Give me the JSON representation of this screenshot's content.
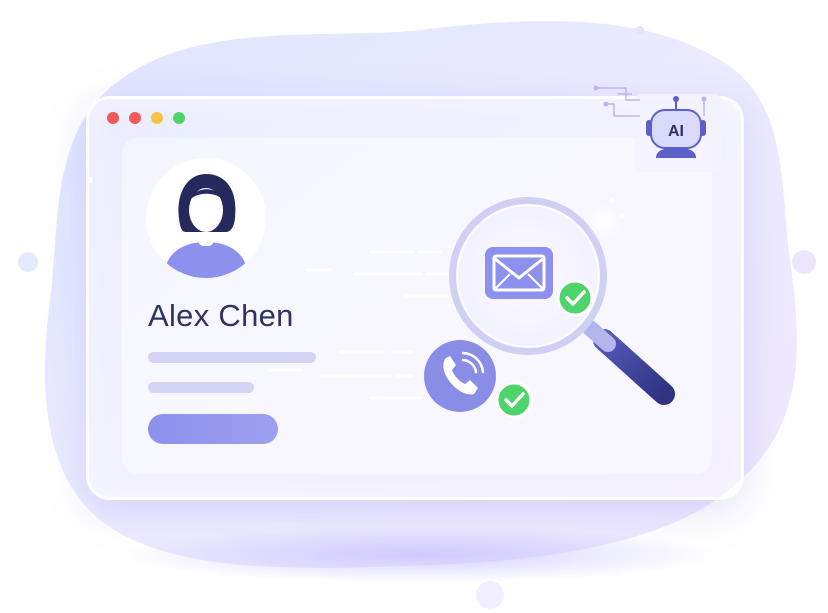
{
  "profile": {
    "name": "Alex Chen",
    "avatar_icon": "person-avatar-icon"
  },
  "window_controls": {
    "colors": [
      "#f25a5a",
      "#f25a5a",
      "#f5c342",
      "#4fd46b"
    ]
  },
  "badge": {
    "label": "AI",
    "icon": "robot-icon"
  },
  "icons": {
    "email": "envelope-icon",
    "phone": "phone-icon",
    "search": "magnifier-icon",
    "check": "check-icon"
  },
  "colors": {
    "accent": "#8d90ec",
    "text": "#2e3363",
    "check": "#4fd46b",
    "handle": "#3a3f8f"
  }
}
